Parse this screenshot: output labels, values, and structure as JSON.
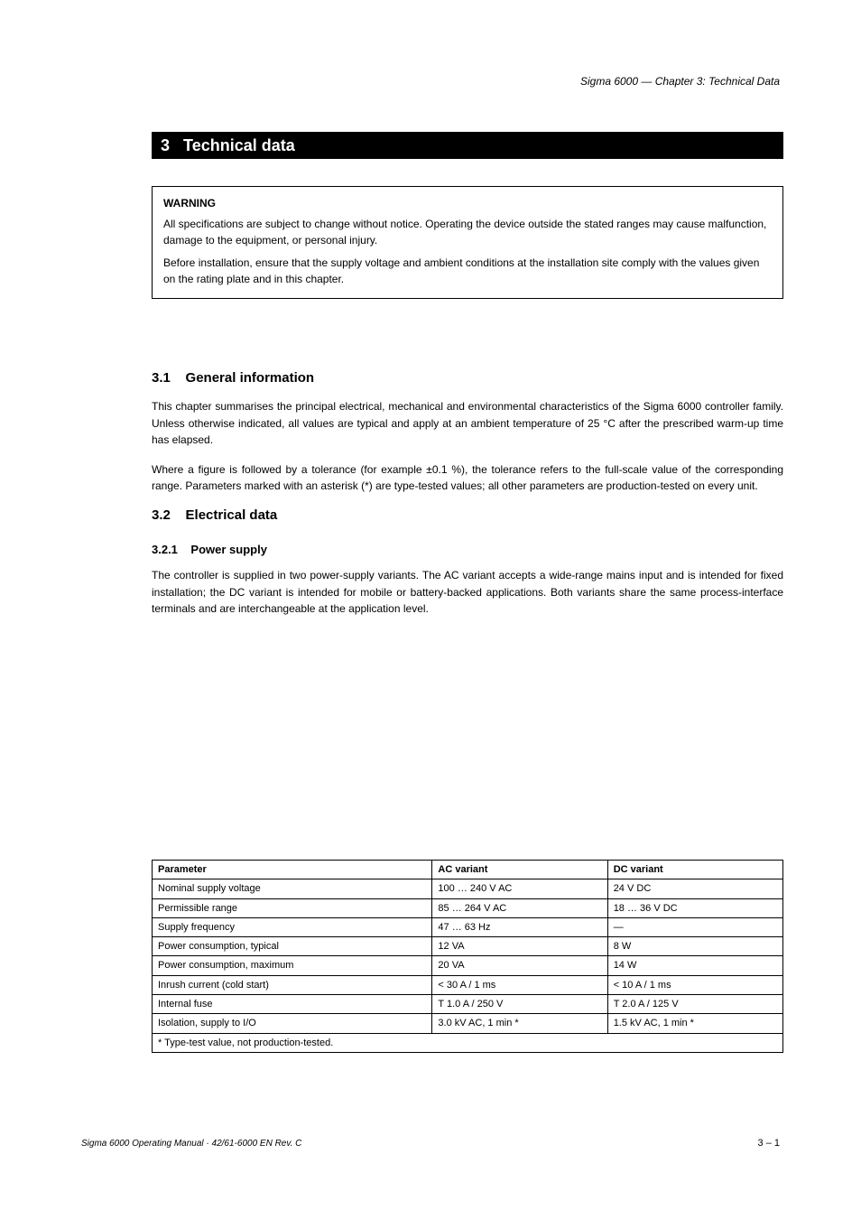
{
  "header": {
    "right": "Sigma 6000 — Chapter 3: Technical Data",
    "pagenum_top": ""
  },
  "section": {
    "number": "3",
    "title": "Technical data"
  },
  "warning": {
    "title": "WARNING",
    "p1": "All specifications are subject to change without notice. Operating the device outside the stated ranges may cause malfunction, damage to the equipment, or personal injury.",
    "p2": "Before installation, ensure that the supply voltage and ambient conditions at the installation site comply with the values given on the rating plate and in this chapter."
  },
  "sub1": {
    "num": "3.1",
    "title": "General information"
  },
  "para1": "This chapter summarises the principal electrical, mechanical and environmental characteristics of the Sigma 6000 controller family. Unless otherwise indicated, all values are typical and apply at an ambient temperature of 25 °C after the prescribed warm-up time has elapsed.",
  "para2": "Where a figure is followed by a tolerance (for example ±0.1 %), the tolerance refers to the full-scale value of the corresponding range. Parameters marked with an asterisk (*) are type-tested values; all other parameters are production-tested on every unit.",
  "sub2": {
    "num": "3.2",
    "title": "Electrical data"
  },
  "sub2a": {
    "num": "3.2.1",
    "title": "Power supply"
  },
  "para3": "The controller is supplied in two power-supply variants. The AC variant accepts a wide-range mains input and is intended for fixed installation; the DC variant is intended for mobile or battery-backed applications. Both variants share the same process-interface terminals and are interchangeable at the application level.",
  "table": {
    "headers": [
      "Parameter",
      "AC variant",
      "DC variant"
    ],
    "rows": [
      [
        "Nominal supply voltage",
        "100 … 240 V AC",
        "24 V DC"
      ],
      [
        "Permissible range",
        "85 … 264 V AC",
        "18 … 36 V DC"
      ],
      [
        "Supply frequency",
        "47 … 63 Hz",
        "—"
      ],
      [
        "Power consumption, typical",
        "12 VA",
        "8 W"
      ],
      [
        "Power consumption, maximum",
        "20 VA",
        "14 W"
      ],
      [
        "Inrush current (cold start)",
        "< 30 A / 1 ms",
        "< 10 A / 1 ms"
      ],
      [
        "Internal fuse",
        "T 1.0 A / 250 V",
        "T 2.0 A / 125 V"
      ],
      [
        "Isolation, supply to I/O",
        "3.0 kV AC, 1 min *",
        "1.5 kV AC, 1 min *"
      ]
    ],
    "footnote": "*  Type-test value, not production-tested."
  },
  "footer": {
    "left": "Sigma 6000 Operating Manual · 42/61-6000 EN Rev. C",
    "right": "3 – 1"
  }
}
